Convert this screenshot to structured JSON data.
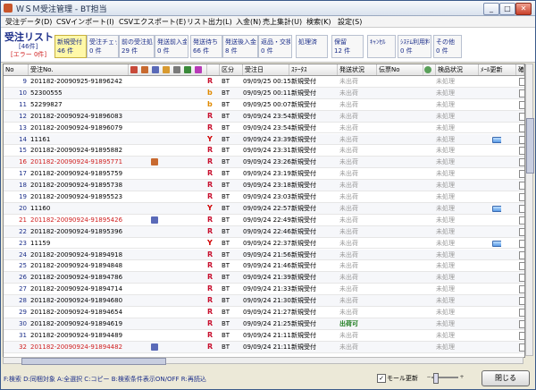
{
  "window": {
    "title": "ＷＳＭ受注管理 - BT担当",
    "min_label": "_",
    "max_label": "□",
    "close_label": "✕"
  },
  "menu": [
    "受注データ(D)",
    "CSVインポート(I)",
    "CSVエクスポート(E)",
    "リスト出力(L)",
    "入金(N)",
    "売上集計(U)",
    "検索(K)",
    "設定(S)"
  ],
  "header": {
    "title": "受注リスト",
    "count": "[46件]",
    "error": "[エラー 0件]"
  },
  "status_tabs": [
    {
      "label": "新規受付",
      "count": "46 件",
      "active": true
    },
    {
      "label": "受注チェック",
      "count": "0 件",
      "active": false
    },
    {
      "label": "前の受注処理",
      "count": "29 件",
      "active": false
    },
    {
      "label": "発送前入金待",
      "count": "0 件",
      "active": false
    },
    {
      "label": "発送待ち",
      "count": "66 件",
      "active": false
    },
    {
      "label": "発送後入金待",
      "count": "8 件",
      "active": false
    },
    {
      "label": "返品・交換",
      "count": "0 件",
      "active": false
    },
    {
      "label": "処理済",
      "count": "",
      "active": false
    },
    {
      "label": "保留",
      "count": "12 件",
      "active": false
    },
    {
      "label": "ｷｬﾝｾﾙ",
      "count": "",
      "active": false
    },
    {
      "label": "ｼｽﾃﾑ利用料金",
      "count": "0 件",
      "active": false
    },
    {
      "label": "その他",
      "count": "0 件",
      "active": false
    }
  ],
  "columns": {
    "no": "No",
    "order_no": "受注No.",
    "channel": "区分",
    "order_date": "受注日",
    "status": "ｽﾃｰﾀｽ",
    "ship_status": "発送状況",
    "slip_no": "伝票No",
    "inspection": "検品状況",
    "mail_update": "ﾒｰﾙ更新",
    "confirm": "確認"
  },
  "rows": [
    {
      "no": "9",
      "order": "201182-20090925-91896242",
      "ch": "R",
      "ch_color": "#c8102e",
      "kubun": "BT",
      "date": "09/09/25 00:15",
      "status": "新規受付",
      "ship": "未出荷",
      "insp": "未処理",
      "red": false,
      "icon": "",
      "mail": false
    },
    {
      "no": "10",
      "order": "52300555",
      "ch": "b",
      "ch_color": "#e08a00",
      "kubun": "BT",
      "date": "09/09/25 00:11",
      "status": "新規受付",
      "ship": "未出荷",
      "insp": "未処理",
      "red": false,
      "icon": "",
      "mail": false
    },
    {
      "no": "11",
      "order": "52299827",
      "ch": "b",
      "ch_color": "#e08a00",
      "kubun": "BT",
      "date": "09/09/25 00:07",
      "status": "新規受付",
      "ship": "未出荷",
      "insp": "未処理",
      "red": false,
      "icon": "",
      "mail": false
    },
    {
      "no": "12",
      "order": "201182-20090924-91896083",
      "ch": "R",
      "ch_color": "#c8102e",
      "kubun": "BT",
      "date": "09/09/24 23:54",
      "status": "新規受付",
      "ship": "未出荷",
      "insp": "未処理",
      "red": false,
      "icon": "",
      "mail": false
    },
    {
      "no": "13",
      "order": "201182-20090924-91896079",
      "ch": "R",
      "ch_color": "#c8102e",
      "kubun": "BT",
      "date": "09/09/24 23:54",
      "status": "新規受付",
      "ship": "未出荷",
      "insp": "未処理",
      "red": false,
      "icon": "",
      "mail": false
    },
    {
      "no": "14",
      "order": "11161",
      "ch": "Y",
      "ch_color": "#d00000",
      "kubun": "BT",
      "date": "09/09/24 23:39",
      "status": "新規受付",
      "ship": "未出荷",
      "insp": "未処理",
      "red": false,
      "icon": "",
      "mail": true
    },
    {
      "no": "15",
      "order": "201182-20090924-91895882",
      "ch": "R",
      "ch_color": "#c8102e",
      "kubun": "BT",
      "date": "09/09/24 23:31",
      "status": "新規受付",
      "ship": "未出荷",
      "insp": "未処理",
      "red": false,
      "icon": "",
      "mail": false
    },
    {
      "no": "16",
      "order": "201182-20090924-91895771",
      "ch": "R",
      "ch_color": "#c8102e",
      "kubun": "BT",
      "date": "09/09/24 23:26",
      "status": "新規受付",
      "ship": "未出荷",
      "insp": "未処理",
      "red": true,
      "icon": "cal",
      "mail": false
    },
    {
      "no": "17",
      "order": "201182-20090924-91895759",
      "ch": "R",
      "ch_color": "#c8102e",
      "kubun": "BT",
      "date": "09/09/24 23:19",
      "status": "新規受付",
      "ship": "未出荷",
      "insp": "未処理",
      "red": false,
      "icon": "",
      "mail": false
    },
    {
      "no": "18",
      "order": "201182-20090924-91895738",
      "ch": "R",
      "ch_color": "#c8102e",
      "kubun": "BT",
      "date": "09/09/24 23:18",
      "status": "新規受付",
      "ship": "未出荷",
      "insp": "未処理",
      "red": false,
      "icon": "",
      "mail": false
    },
    {
      "no": "19",
      "order": "201182-20090924-91895523",
      "ch": "R",
      "ch_color": "#c8102e",
      "kubun": "BT",
      "date": "09/09/24 23:03",
      "status": "新規受付",
      "ship": "未出荷",
      "insp": "未処理",
      "red": false,
      "icon": "",
      "mail": false
    },
    {
      "no": "20",
      "order": "11160",
      "ch": "Y",
      "ch_color": "#d00000",
      "kubun": "BT",
      "date": "09/09/24 22:57",
      "status": "新規受付",
      "ship": "未出荷",
      "insp": "未処理",
      "red": false,
      "icon": "",
      "mail": true
    },
    {
      "no": "21",
      "order": "201182-20090924-91895426",
      "ch": "R",
      "ch_color": "#c8102e",
      "kubun": "BT",
      "date": "09/09/24 22:49",
      "status": "新規受付",
      "ship": "未出荷",
      "insp": "未処理",
      "red": true,
      "icon": "user",
      "mail": false
    },
    {
      "no": "22",
      "order": "201182-20090924-91895396",
      "ch": "R",
      "ch_color": "#c8102e",
      "kubun": "BT",
      "date": "09/09/24 22:46",
      "status": "新規受付",
      "ship": "未出荷",
      "insp": "未処理",
      "red": false,
      "icon": "",
      "mail": false
    },
    {
      "no": "23",
      "order": "11159",
      "ch": "Y",
      "ch_color": "#d00000",
      "kubun": "BT",
      "date": "09/09/24 22:37",
      "status": "新規受付",
      "ship": "未出荷",
      "insp": "未処理",
      "red": false,
      "icon": "",
      "mail": true
    },
    {
      "no": "24",
      "order": "201182-20090924-91894918",
      "ch": "R",
      "ch_color": "#c8102e",
      "kubun": "BT",
      "date": "09/09/24 21:56",
      "status": "新規受付",
      "ship": "未出荷",
      "insp": "未処理",
      "red": false,
      "icon": "",
      "mail": false
    },
    {
      "no": "25",
      "order": "201182-20090924-91894848",
      "ch": "R",
      "ch_color": "#c8102e",
      "kubun": "BT",
      "date": "09/09/24 21:46",
      "status": "新規受付",
      "ship": "未出荷",
      "insp": "未処理",
      "red": false,
      "icon": "",
      "mail": false
    },
    {
      "no": "26",
      "order": "201182-20090924-91894786",
      "ch": "R",
      "ch_color": "#c8102e",
      "kubun": "BT",
      "date": "09/09/24 21:39",
      "status": "新規受付",
      "ship": "未出荷",
      "insp": "未処理",
      "red": false,
      "icon": "",
      "mail": false
    },
    {
      "no": "27",
      "order": "201182-20090924-91894714",
      "ch": "R",
      "ch_color": "#c8102e",
      "kubun": "BT",
      "date": "09/09/24 21:33",
      "status": "新規受付",
      "ship": "未出荷",
      "insp": "未処理",
      "red": false,
      "icon": "",
      "mail": false
    },
    {
      "no": "28",
      "order": "201182-20090924-91894680",
      "ch": "R",
      "ch_color": "#c8102e",
      "kubun": "BT",
      "date": "09/09/24 21:30",
      "status": "新規受付",
      "ship": "未出荷",
      "insp": "未処理",
      "red": false,
      "icon": "",
      "mail": false
    },
    {
      "no": "29",
      "order": "201182-20090924-91894654",
      "ch": "R",
      "ch_color": "#c8102e",
      "kubun": "BT",
      "date": "09/09/24 21:27",
      "status": "新規受付",
      "ship": "未出荷",
      "insp": "未処理",
      "red": false,
      "icon": "",
      "mail": false
    },
    {
      "no": "30",
      "order": "201182-20090924-91894619",
      "ch": "R",
      "ch_color": "#c8102e",
      "kubun": "BT",
      "date": "09/09/24 21:25",
      "status": "新規受付",
      "ship": "出荷可",
      "insp": "未処理",
      "red": false,
      "icon": "gear",
      "mail": false
    },
    {
      "no": "31",
      "order": "201182-20090924-91894489",
      "ch": "R",
      "ch_color": "#c8102e",
      "kubun": "BT",
      "date": "09/09/24 21:11",
      "status": "新規受付",
      "ship": "未出荷",
      "insp": "未処理",
      "red": false,
      "icon": "",
      "mail": false
    },
    {
      "no": "32",
      "order": "201182-20090924-91894482",
      "ch": "R",
      "ch_color": "#c8102e",
      "kubun": "BT",
      "date": "09/09/24 21:11",
      "status": "新規受付",
      "ship": "未出荷",
      "insp": "未処理",
      "red": true,
      "icon": "user",
      "mail": false
    }
  ],
  "footer": {
    "hint": "F:検索 D:同梱対象 A:全選択 C:コピー B:検索条件表示ON/OFF R:再読込",
    "mail_update_label": "モール更新",
    "mail_update_checked": "✓",
    "slider_minus": "−",
    "slider_plus": "+",
    "close_label": "閉じる"
  }
}
